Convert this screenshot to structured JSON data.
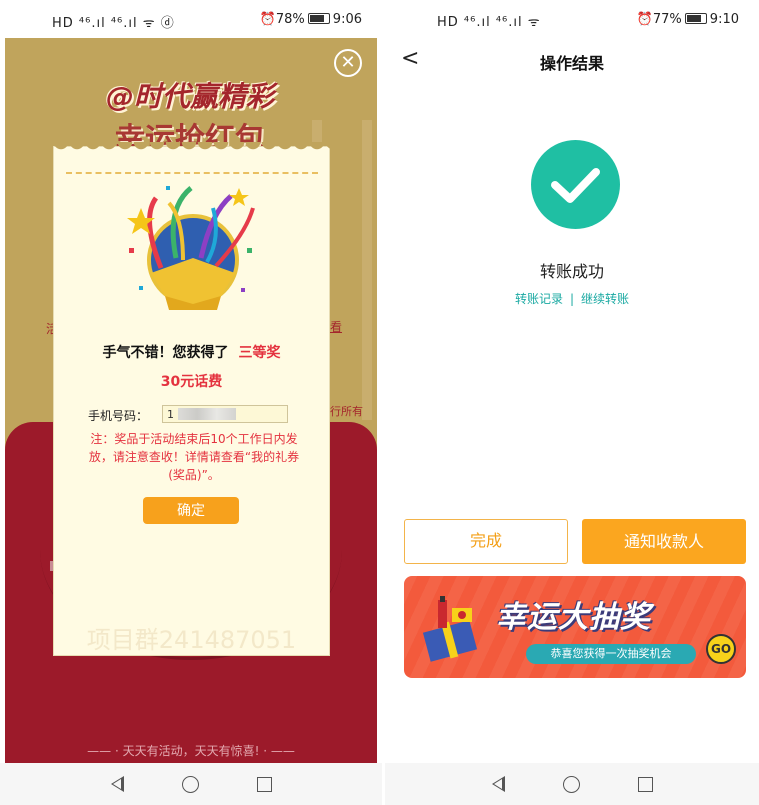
{
  "left_screen": {
    "status_bar": {
      "left_icons": "HD ⁴⁶.ıl ⁴⁶.ıl ᯤ ⓓ",
      "battery": "78%",
      "time": "9:06"
    },
    "promo": {
      "title_line1": "@时代赢精彩",
      "title_line2": "幸运抢红包",
      "side_left": "活",
      "side_right1": "看",
      "side_right2": "行所有",
      "footer_slogan": "—— · 天天有活动，天天有惊喜! · ——"
    },
    "modal": {
      "headline": "手气不错！您获得了",
      "prize_level": "三等奖",
      "prize_name": "30元话费",
      "phone_label": "手机号码：",
      "phone_value": "1",
      "note": "注：奖品于活动结束后10个工作日内发放，请注意查收！详情请查看“我的礼券(奖品)”。",
      "confirm_label": "确定",
      "watermark": "项目群241487051"
    },
    "colors": {
      "accent": "#e4323f",
      "button": "#f7a11c",
      "promo_bg": "#c0a45c",
      "red_bg": "#9c1a2a"
    }
  },
  "right_screen": {
    "status_bar": {
      "left_icons": "HD ⁴⁶.ıl ⁴⁶.ıl ᯤ",
      "battery": "77%",
      "time": "9:10"
    },
    "header": {
      "title": "操作结果"
    },
    "result": {
      "status_text": "转账成功",
      "link_records": "转账记录",
      "link_separator": "|",
      "link_continue": "继续转账"
    },
    "actions": {
      "done_label": "完成",
      "notify_label": "通知收款人"
    },
    "banner": {
      "title": "幸运大抽奖",
      "subtitle": "恭喜您获得一次抽奖机会",
      "go_label": "GO"
    },
    "colors": {
      "success": "#1fbfa3",
      "link": "#1aa9a2",
      "primary": "#fba61f",
      "banner": "#f35a3c"
    }
  }
}
